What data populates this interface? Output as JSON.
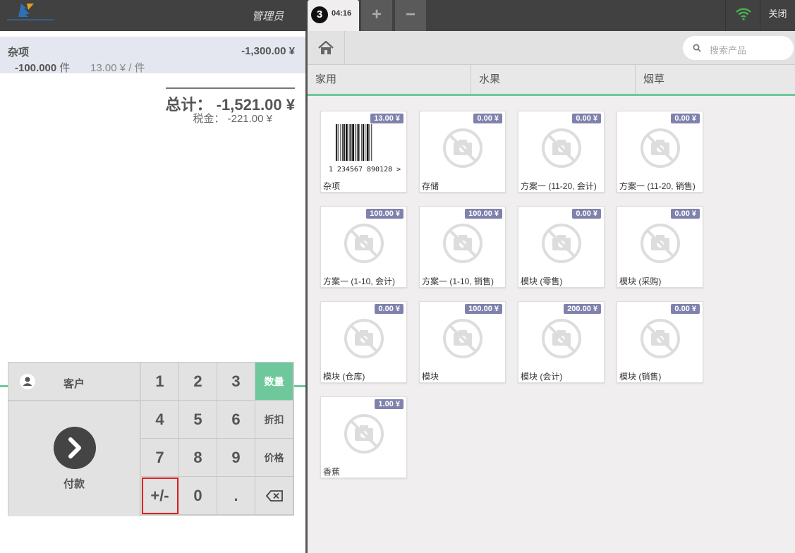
{
  "topbar": {
    "user": "管理员",
    "order_number": "3",
    "order_time": "04:16",
    "add_label": "+",
    "remove_label": "−",
    "close_label": "关闭"
  },
  "order": {
    "line": {
      "name": "杂项",
      "price": "-1,300.00 ¥",
      "qty": "-100.000",
      "qty_unit": "件",
      "unit_price": "13.00 ¥ / 件"
    },
    "total_label": "总计：",
    "total_value": "-1,521.00 ¥",
    "tax_label": "税金：",
    "tax_value": "-221.00 ¥"
  },
  "pad": {
    "customer_label": "客户",
    "pay_label": "付款",
    "keys": [
      "1",
      "2",
      "3",
      "4",
      "5",
      "6",
      "7",
      "8",
      "9",
      "+/-",
      "0",
      "."
    ],
    "modes": [
      "数量",
      "折扣",
      "价格"
    ],
    "active_mode": "数量",
    "highlighted_key": "+/-"
  },
  "search": {
    "placeholder": "搜索产品"
  },
  "categories": [
    "家用",
    "水果",
    "烟草"
  ],
  "products": [
    {
      "name": "杂项",
      "price": "13.00 ¥",
      "barcode": "1 234567 890128 >"
    },
    {
      "name": "存储",
      "price": "0.00 ¥"
    },
    {
      "name": "方案一 (11-20, 会计)",
      "price": "0.00 ¥"
    },
    {
      "name": "方案一 (11-20, 销售)",
      "price": "0.00 ¥"
    },
    {
      "name": "方案一 (1-10, 会计)",
      "price": "100.00 ¥"
    },
    {
      "name": "方案一 (1-10, 销售)",
      "price": "100.00 ¥"
    },
    {
      "name": "模块 (零售)",
      "price": "0.00 ¥"
    },
    {
      "name": "模块 (采购)",
      "price": "0.00 ¥"
    },
    {
      "name": "模块 (仓库)",
      "price": "0.00 ¥"
    },
    {
      "name": "模块",
      "price": "100.00 ¥"
    },
    {
      "name": "模块 (会计)",
      "price": "200.00 ¥"
    },
    {
      "name": "模块 (销售)",
      "price": "0.00 ¥"
    },
    {
      "name": "香蕉",
      "price": "1.00 ¥"
    }
  ],
  "colors": {
    "accent_green": "#6ec89b",
    "price_badge": "#7f82ac",
    "topbar": "#414141",
    "selected_line": "#e4e6f0",
    "highlight_outline": "#e02020"
  }
}
